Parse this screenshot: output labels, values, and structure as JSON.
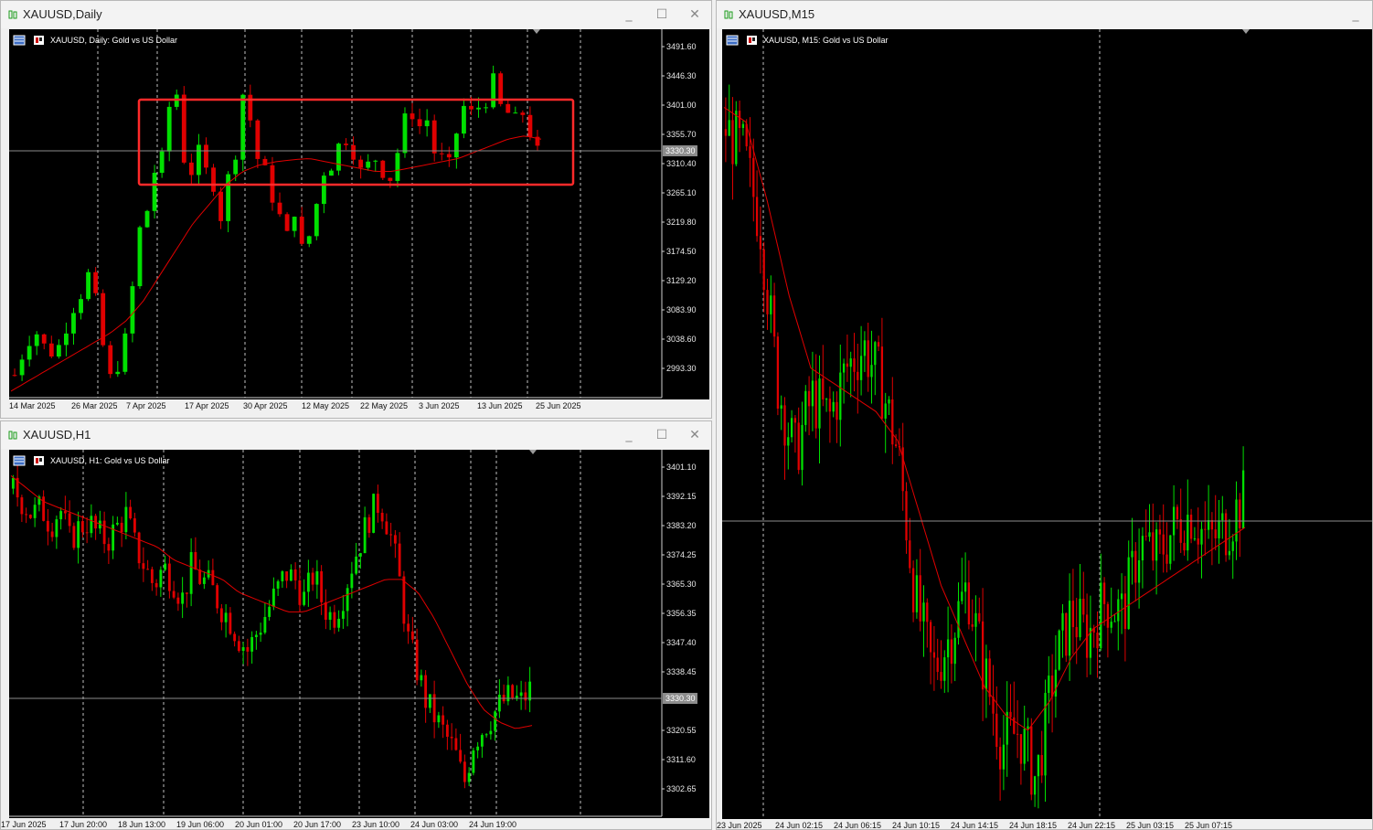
{
  "windows": {
    "daily": {
      "title": "XAUUSD,Daily",
      "chart_label": "XAUUSD, Daily:  Gold vs US Dollar",
      "price_labels": [
        "3491.60",
        "3446.30",
        "3401.00",
        "3355.70",
        "3310.40",
        "3265.10",
        "3219.80",
        "3174.50",
        "3129.20",
        "3083.90",
        "3038.60",
        "2993.30"
      ],
      "current_price": "3330.30",
      "x_labels": [
        "14 Mar 2025",
        "26 Mar 2025",
        "7 Apr 2025",
        "17 Apr 2025",
        "30 Apr 2025",
        "12 May 2025",
        "22 May 2025",
        "3 Jun 2025",
        "13 Jun 2025",
        "25 Jun 2025"
      ]
    },
    "h1": {
      "title": "XAUUSD,H1",
      "chart_label": "XAUUSD, H1:  Gold vs US Dollar",
      "price_labels": [
        "3401.10",
        "3392.15",
        "3383.20",
        "3374.25",
        "3365.30",
        "3356.35",
        "3347.40",
        "3338.45",
        "3320.55",
        "3311.60",
        "3302.65"
      ],
      "current_price": "3330.30",
      "x_labels": [
        "17 Jun 2025",
        "17 Jun 20:00",
        "18 Jun 13:00",
        "19 Jun 06:00",
        "20 Jun 01:00",
        "20 Jun 17:00",
        "23 Jun 10:00",
        "24 Jun 03:00",
        "24 Jun 19:00"
      ]
    },
    "m15": {
      "title": "XAUUSD,M15",
      "chart_label": "XAUUSD, M15:  Gold vs US Dollar",
      "x_labels": [
        "23 Jun 2025",
        "24 Jun 02:15",
        "24 Jun 06:15",
        "24 Jun 10:15",
        "24 Jun 14:15",
        "24 Jun 18:15",
        "24 Jun 22:15",
        "25 Jun 03:15",
        "25 Jun 07:15"
      ]
    }
  },
  "colors": {
    "bull": "#00e000",
    "bear": "#e00000",
    "ma": "#e00000",
    "grid": "#ffffff",
    "price_line": "#8c8c8c",
    "highlight": "#ff2a2a"
  },
  "icons": {
    "window": "candlestick-icon",
    "minimize": "minimize-icon",
    "maximize": "maximize-icon",
    "close": "close-icon"
  },
  "chart_data": [
    {
      "type": "candlestick",
      "symbol": "XAUUSD",
      "timeframe": "Daily",
      "ylim": [
        2950,
        3520
      ],
      "x": [
        "14 Mar 2025",
        "26 Mar 2025",
        "7 Apr 2025",
        "17 Apr 2025",
        "30 Apr 2025",
        "12 May 2025",
        "22 May 2025",
        "3 Jun 2025",
        "13 Jun 2025",
        "25 Jun 2025"
      ],
      "close_path": [
        2985,
        3015,
        3040,
        3050,
        3030,
        3020,
        3030,
        3060,
        3090,
        3110,
        3140,
        3100,
        3030,
        2980,
        3000,
        3040,
        3120,
        3210,
        3240,
        3300,
        3320,
        3400,
        3420,
        3320,
        3300,
        3330,
        3300,
        3280,
        3230,
        3290,
        3330,
        3420,
        3380,
        3320,
        3300,
        3260,
        3230,
        3200,
        3240,
        3180,
        3200,
        3250,
        3300,
        3310,
        3340,
        3350,
        3330,
        3300,
        3310,
        3320,
        3300,
        3290,
        3330,
        3380,
        3390,
        3370,
        3380,
        3330,
        3320,
        3310,
        3360,
        3400,
        3390,
        3400,
        3410,
        3440,
        3400,
        3390,
        3380,
        3390,
        3360,
        3330
      ],
      "ma_path": [
        2960,
        2975,
        2990,
        3005,
        3020,
        3035,
        3050,
        3070,
        3100,
        3140,
        3180,
        3220,
        3250,
        3280,
        3300,
        3310,
        3315,
        3318,
        3320,
        3315,
        3310,
        3305,
        3300,
        3300,
        3305,
        3310,
        3315,
        3320,
        3330,
        3340,
        3350,
        3355,
        3350
      ],
      "highlight_box": {
        "top": 3410,
        "bottom": 3285,
        "from": "7 Apr 2025",
        "to": "25 Jun 2025"
      }
    },
    {
      "type": "candlestick",
      "symbol": "XAUUSD",
      "timeframe": "H1",
      "ylim": [
        3295,
        3408
      ],
      "x": [
        "17 Jun 2025",
        "17 Jun 20:00",
        "18 Jun 13:00",
        "19 Jun 06:00",
        "20 Jun 01:00",
        "20 Jun 17:00",
        "23 Jun 10:00",
        "24 Jun 03:00",
        "24 Jun 19:00"
      ],
      "close_path": [
        3396,
        3392,
        3388,
        3390,
        3385,
        3390,
        3380,
        3384,
        3386,
        3382,
        3380,
        3384,
        3388,
        3378,
        3372,
        3366,
        3372,
        3368,
        3362,
        3372,
        3368,
        3366,
        3360,
        3356,
        3350,
        3346,
        3352,
        3358,
        3364,
        3370,
        3368,
        3362,
        3370,
        3360,
        3356,
        3362,
        3372,
        3380,
        3388,
        3392,
        3384,
        3370,
        3350,
        3340,
        3330,
        3325,
        3320,
        3315,
        3305,
        3318,
        3322,
        3326,
        3330,
        3332,
        3330,
        3334
      ],
      "ma_path": [
        3400,
        3396,
        3392,
        3390,
        3388,
        3386,
        3384,
        3382,
        3380,
        3378,
        3374,
        3372,
        3370,
        3368,
        3364,
        3362,
        3360,
        3358,
        3358,
        3360,
        3362,
        3364,
        3366,
        3368,
        3368,
        3364,
        3356,
        3346,
        3336,
        3328,
        3324,
        3322,
        3323
      ]
    },
    {
      "type": "candlestick",
      "symbol": "XAUUSD",
      "timeframe": "M15",
      "ylim": [
        3290,
        3395
      ],
      "x": [
        "23 Jun 2025",
        "24 Jun 02:15",
        "24 Jun 06:15",
        "24 Jun 10:15",
        "24 Jun 14:15",
        "24 Jun 18:15",
        "24 Jun 22:15",
        "25 Jun 03:15",
        "25 Jun 07:15"
      ],
      "close_path": [
        3385,
        3382,
        3372,
        3350,
        3340,
        3348,
        3345,
        3352,
        3355,
        3350,
        3340,
        3320,
        3310,
        3315,
        3322,
        3310,
        3300,
        3302,
        3295,
        3310,
        3318,
        3315,
        3320,
        3318,
        3328,
        3326,
        3330,
        3332,
        3328,
        3330,
        3334
      ],
      "ma_path": [
        3388,
        3386,
        3375,
        3362,
        3352,
        3350,
        3348,
        3346,
        3342,
        3332,
        3322,
        3315,
        3308,
        3304,
        3302,
        3306,
        3312,
        3316,
        3318,
        3320,
        3322,
        3324,
        3326,
        3328,
        3330
      ]
    }
  ]
}
